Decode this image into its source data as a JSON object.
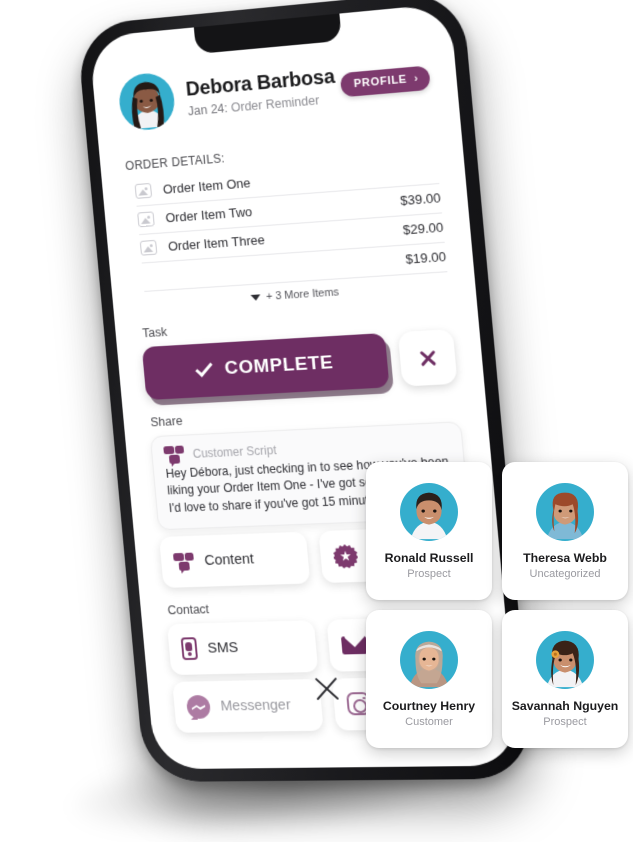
{
  "header": {
    "name": "Debora Barbosa",
    "date": "Jan 24:",
    "subject": "Order Reminder",
    "profile_label": "PROFILE",
    "profile_chevron": "›",
    "avatar_icon": "user-avatar",
    "avatar_bg": "#35aecd"
  },
  "order": {
    "section_title": "ORDER DETAILS:",
    "items": [
      {
        "name": "Order Item One",
        "price": ""
      },
      {
        "name": "Order Item Two",
        "price": "$39.00"
      },
      {
        "name": "Order Item Three",
        "price": "$29.00"
      },
      {
        "name": "",
        "price": "$19.00"
      }
    ],
    "more_label": "+ 3 More Items",
    "caret_icon": "caret-down-icon",
    "item_icon": "image-placeholder-icon"
  },
  "task": {
    "label": "Task",
    "complete_label": "COMPLETE",
    "check_icon": "check-icon",
    "dismiss_icon": "close-icon",
    "accent": "#6e2e63"
  },
  "share": {
    "label": "Share",
    "script_icon": "customer-script-icon",
    "script_title": "Customer Script",
    "script_body": "Hey Débora, just checking in to see how you've been liking your Order Item One - I've got some great tips I'd love to share if you've got 15 minutes.",
    "tiles": [
      {
        "label": "Content",
        "icon": "content-media-icon",
        "muted": false
      },
      {
        "label": "Recommend",
        "icon": "recommend-badge-icon",
        "muted": false
      }
    ]
  },
  "contact": {
    "label": "Contact",
    "tiles": [
      {
        "label": "SMS",
        "icon": "sms-phone-icon",
        "muted": false
      },
      {
        "label": "Email",
        "icon": "envelope-icon",
        "muted": false
      },
      {
        "label": "Messenger",
        "icon": "messenger-icon",
        "muted": true
      },
      {
        "label": "Instagram",
        "icon": "instagram-icon",
        "muted": true
      }
    ]
  },
  "close_icon": "close-screen-icon",
  "contact_cards": [
    {
      "name": "Ronald Russell",
      "role": "Prospect",
      "avatar_icon": "contact-avatar"
    },
    {
      "name": "Theresa Webb",
      "role": "Uncategorized",
      "avatar_icon": "contact-avatar"
    },
    {
      "name": "Courtney Henry",
      "role": "Customer",
      "avatar_icon": "contact-avatar"
    },
    {
      "name": "Savannah Nguyen",
      "role": "Prospect",
      "avatar_icon": "contact-avatar"
    }
  ]
}
